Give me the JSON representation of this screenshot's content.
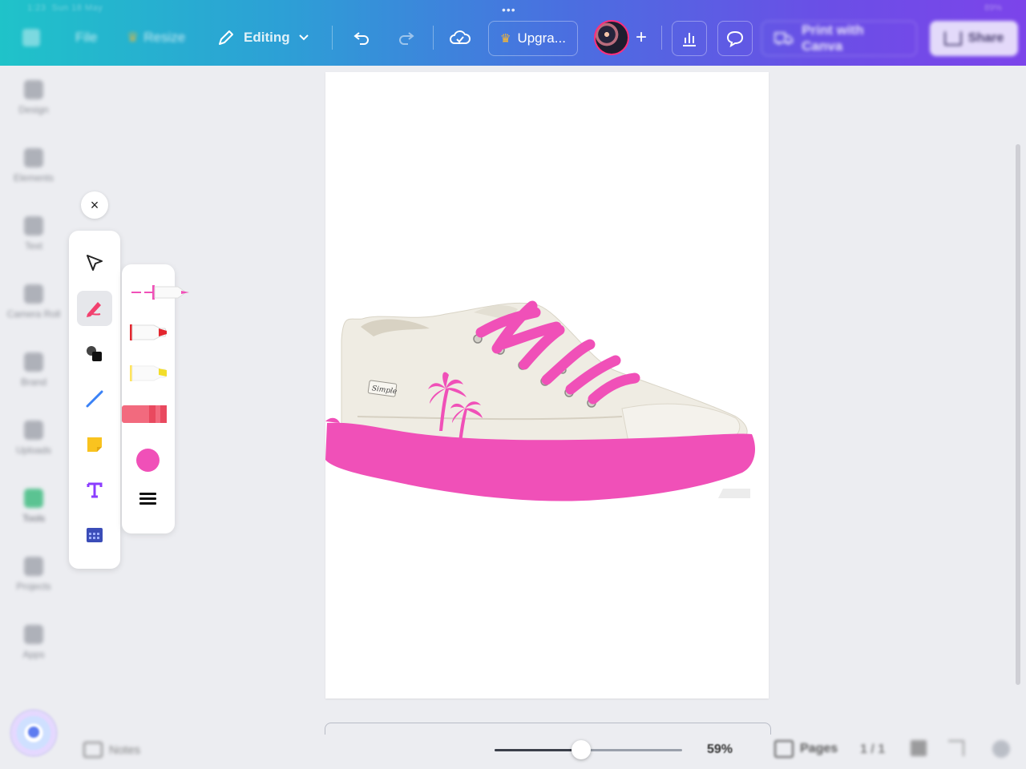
{
  "status_bar": {
    "time": "1:23",
    "date": "Sun 18 May",
    "right": "89%"
  },
  "toolbar": {
    "home": "Home",
    "file": "File",
    "resize": "Resize",
    "editing": "Editing",
    "upgrade": "Upgra...",
    "add": "+",
    "print": "Print with Canva",
    "share": "Share"
  },
  "sidebar": {
    "items": [
      {
        "label": "Design",
        "icon": "design-icon"
      },
      {
        "label": "Elements",
        "icon": "elements-icon"
      },
      {
        "label": "Text",
        "icon": "text-icon"
      },
      {
        "label": "Camera Roll",
        "icon": "camera-icon"
      },
      {
        "label": "Brand",
        "icon": "brand-icon"
      },
      {
        "label": "Uploads",
        "icon": "uploads-icon"
      },
      {
        "label": "Tools",
        "icon": "tools-icon"
      },
      {
        "label": "Projects",
        "icon": "folder-icon"
      },
      {
        "label": "Apps",
        "icon": "apps-icon"
      }
    ],
    "active_index": 6
  },
  "draw_tools": {
    "close": "×",
    "tools": [
      "select-arrow-icon",
      "pen-icon",
      "shapes-icon",
      "line-icon",
      "sticky-note-icon",
      "text-icon",
      "table-icon"
    ],
    "selected_tool": 1,
    "brushes": [
      "pen-brush",
      "marker-brush",
      "highlighter-brush",
      "eraser-brush"
    ],
    "selected_brush": 0,
    "color": "#f050b8"
  },
  "canvas": {
    "brand_tag": "Simple",
    "accent": "#f050b8"
  },
  "bottom_bar": {
    "notes": "Notes",
    "zoom": "59%",
    "zoom_level": 0.46,
    "pages": "Pages",
    "page_count": "1 / 1"
  }
}
